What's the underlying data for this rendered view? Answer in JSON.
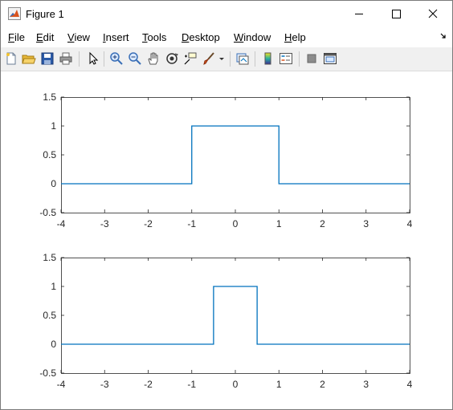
{
  "window": {
    "title": "Figure 1",
    "icons": [
      "matlab-logo-icon",
      "minimize-icon",
      "maximize-icon",
      "close-icon"
    ]
  },
  "menu": {
    "items": [
      {
        "label": "File",
        "mnemonic": "F"
      },
      {
        "label": "Edit",
        "mnemonic": "E"
      },
      {
        "label": "View",
        "mnemonic": "V"
      },
      {
        "label": "Insert",
        "mnemonic": "I"
      },
      {
        "label": "Tools",
        "mnemonic": "T"
      },
      {
        "label": "Desktop",
        "mnemonic": "D"
      },
      {
        "label": "Window",
        "mnemonic": "W"
      },
      {
        "label": "Help",
        "mnemonic": "H"
      }
    ],
    "dock_icon": "dock-arrow-icon"
  },
  "toolbar": {
    "icons": [
      "new-figure-icon",
      "open-file-icon",
      "save-icon",
      "print-icon",
      "edit-plot-arrow-icon",
      "zoom-in-icon",
      "zoom-out-icon",
      "pan-hand-icon",
      "rotate-3d-icon",
      "data-cursor-icon",
      "brush-icon",
      "link-plot-icon",
      "colorbar-icon",
      "legend-icon",
      "hide-plot-tools-icon",
      "show-plot-tools-icon"
    ]
  },
  "chart_data": [
    {
      "type": "line",
      "series": [
        {
          "x": [
            -4,
            -1,
            -1,
            1,
            1,
            4
          ],
          "y": [
            0,
            0,
            1,
            1,
            0,
            0
          ]
        }
      ],
      "xlim": [
        -4,
        4
      ],
      "ylim": [
        -0.5,
        1.5
      ],
      "xticks": [
        "-4",
        "-3",
        "-2",
        "-1",
        "0",
        "1",
        "2",
        "3",
        "4"
      ],
      "yticks": [
        "-0.5",
        "0",
        "0.5",
        "1",
        "1.5"
      ],
      "color": "#0072bd",
      "grid": false
    },
    {
      "type": "line",
      "series": [
        {
          "x": [
            -4,
            -0.5,
            -0.5,
            0.5,
            0.5,
            4
          ],
          "y": [
            0,
            0,
            1,
            1,
            0,
            0
          ]
        }
      ],
      "xlim": [
        -4,
        4
      ],
      "ylim": [
        -0.5,
        1.5
      ],
      "xticks": [
        "-4",
        "-3",
        "-2",
        "-1",
        "0",
        "1",
        "2",
        "3",
        "4"
      ],
      "yticks": [
        "-0.5",
        "0",
        "0.5",
        "1",
        "1.5"
      ],
      "color": "#0072bd",
      "grid": false
    }
  ]
}
